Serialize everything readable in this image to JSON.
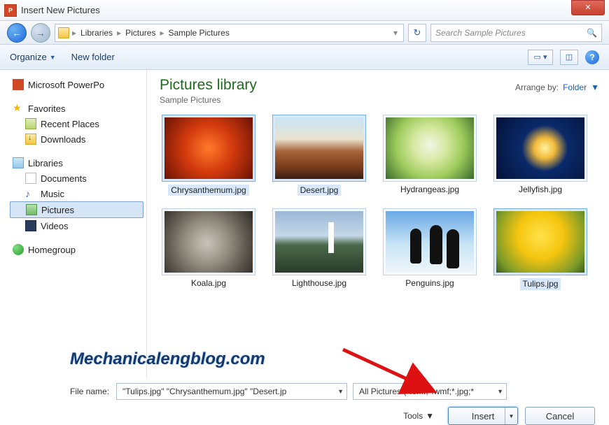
{
  "title": "Insert New Pictures",
  "breadcrumb": {
    "root": "Libraries",
    "folder": "Pictures",
    "sub": "Sample Pictures"
  },
  "search": {
    "placeholder": "Search Sample Pictures"
  },
  "toolbar": {
    "organize": "Organize",
    "newfolder": "New folder"
  },
  "sidebar": {
    "powerpoint": "Microsoft PowerPo",
    "favorites": "Favorites",
    "recent": "Recent Places",
    "downloads": "Downloads",
    "libraries": "Libraries",
    "documents": "Documents",
    "music": "Music",
    "pictures": "Pictures",
    "videos": "Videos",
    "homegroup": "Homegroup"
  },
  "library": {
    "title": "Pictures library",
    "subtitle": "Sample Pictures",
    "arrange_label": "Arrange by:",
    "arrange_value": "Folder"
  },
  "thumbs": [
    {
      "name": "Chrysanthemum.jpg",
      "img": "img-chry",
      "selected": true
    },
    {
      "name": "Desert.jpg",
      "img": "img-desert",
      "selected": true
    },
    {
      "name": "Hydrangeas.jpg",
      "img": "img-hydra",
      "selected": false
    },
    {
      "name": "Jellyfish.jpg",
      "img": "img-jelly",
      "selected": false
    },
    {
      "name": "Koala.jpg",
      "img": "img-koala",
      "selected": false
    },
    {
      "name": "Lighthouse.jpg",
      "img": "img-light",
      "selected": false
    },
    {
      "name": "Penguins.jpg",
      "img": "img-peng",
      "selected": false
    },
    {
      "name": "Tulips.jpg",
      "img": "img-tulip",
      "selected": true
    }
  ],
  "footer": {
    "filename_label": "File name:",
    "filename_value": "\"Tulips.jpg\" \"Chrysanthemum.jpg\" \"Desert.jp",
    "filter": "All Pictures (*.emf;*.wmf;*.jpg;*",
    "tools": "Tools",
    "insert": "Insert",
    "cancel": "Cancel"
  },
  "watermark": "Mechanicalengblog.com"
}
